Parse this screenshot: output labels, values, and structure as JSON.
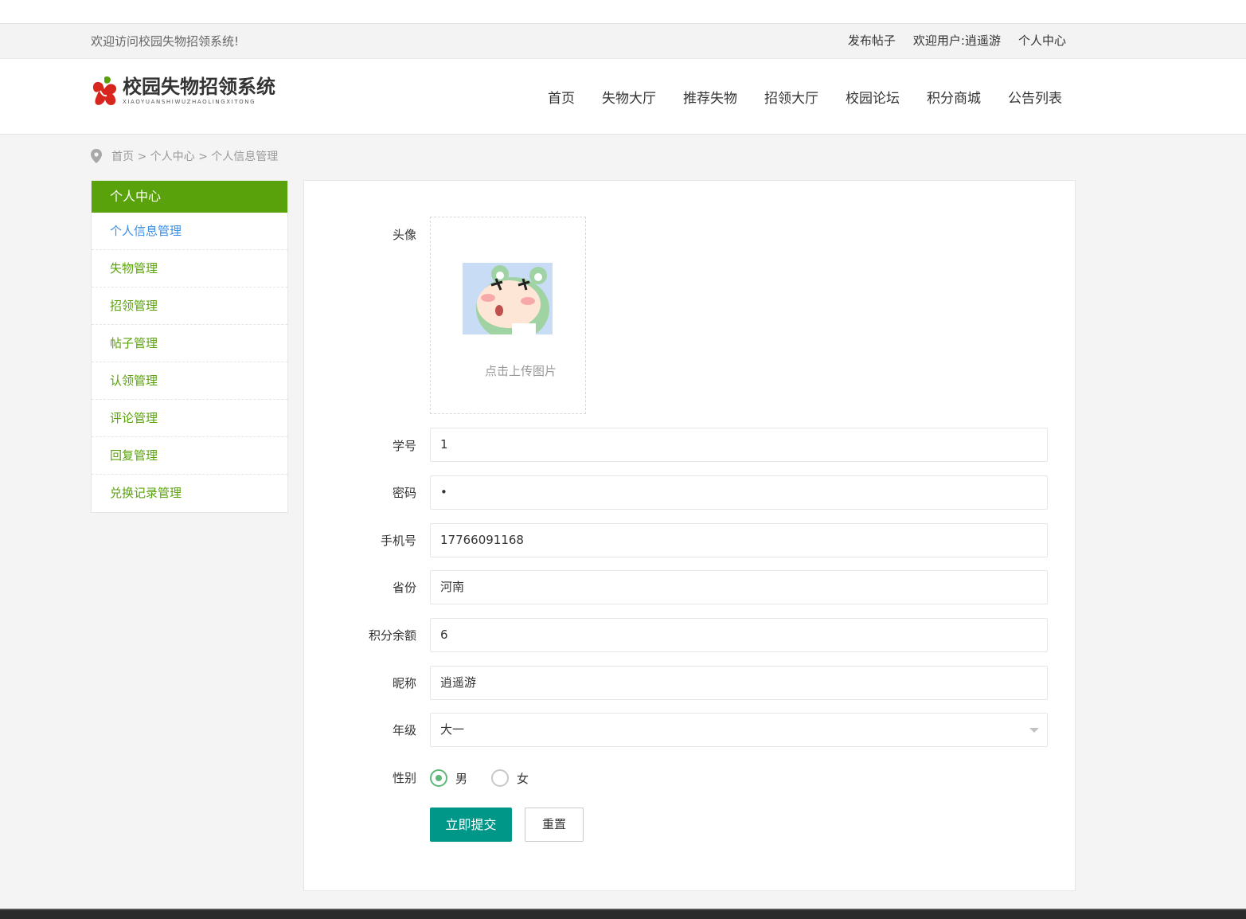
{
  "topbar": {
    "welcome": "欢迎访问校园失物招领系统!",
    "links": [
      "发布帖子",
      "欢迎用户:逍遥游",
      "个人中心"
    ]
  },
  "logo": {
    "title": "校园失物招领系统",
    "subtitle": "XIAOYUANSHIWUZHAOLINGXITONG",
    "mark_colors": {
      "leaf": "#5aa20b",
      "fruit": "#d7261d"
    }
  },
  "nav": [
    "首页",
    "失物大厅",
    "推荐失物",
    "招领大厅",
    "校园论坛",
    "积分商城",
    "公告列表"
  ],
  "breadcrumb": "首页 > 个人中心 > 个人信息管理",
  "sidebar": {
    "title": "个人中心",
    "items": [
      "个人信息管理",
      "失物管理",
      "招领管理",
      "帖子管理",
      "认领管理",
      "评论管理",
      "回复管理",
      "兑换记录管理"
    ],
    "active_index": 0
  },
  "form": {
    "avatar_label": "头像",
    "upload_tip": "点击上传图片",
    "student_id_label": "学号",
    "student_id": "1",
    "password_label": "密码",
    "password": "•",
    "phone_label": "手机号",
    "phone": "17766091168",
    "province_label": "省份",
    "province": "河南",
    "points_label": "积分余额",
    "points": "6",
    "nickname_label": "昵称",
    "nickname": "逍遥游",
    "grade_label": "年级",
    "grade": "大一",
    "gender_label": "性别",
    "gender_options": [
      "男",
      "女"
    ],
    "gender_selected": "男",
    "submit_label": "立即提交",
    "reset_label": "重置"
  },
  "colors": {
    "accent_green": "#5aa20b",
    "submit_teal": "#009688",
    "radio_green": "#5fb878",
    "active_link_blue": "#3a8ee6"
  }
}
